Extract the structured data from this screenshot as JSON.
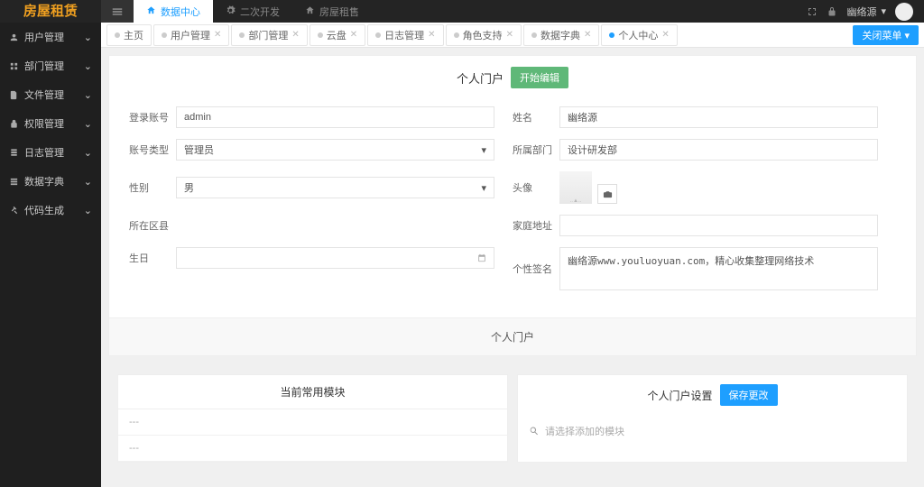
{
  "logo": "房屋租赁",
  "topnav": [
    {
      "label": "数据中心",
      "active": true
    },
    {
      "label": "二次开发",
      "active": false
    },
    {
      "label": "房屋租售",
      "active": false
    }
  ],
  "user": {
    "name": "幽络源"
  },
  "sidebar": [
    {
      "label": "用户管理"
    },
    {
      "label": "部门管理"
    },
    {
      "label": "文件管理"
    },
    {
      "label": "权限管理"
    },
    {
      "label": "日志管理"
    },
    {
      "label": "数据字典"
    },
    {
      "label": "代码生成"
    }
  ],
  "tabs": [
    {
      "label": "主页",
      "closable": false,
      "active": false
    },
    {
      "label": "用户管理",
      "closable": true,
      "active": false
    },
    {
      "label": "部门管理",
      "closable": true,
      "active": false
    },
    {
      "label": "云盘",
      "closable": true,
      "active": false
    },
    {
      "label": "日志管理",
      "closable": true,
      "active": false
    },
    {
      "label": "角色支持",
      "closable": true,
      "active": false
    },
    {
      "label": "数据字典",
      "closable": true,
      "active": false
    },
    {
      "label": "个人中心",
      "closable": true,
      "active": true
    }
  ],
  "close_all_label": "关闭菜单 ▾",
  "panel1": {
    "title": "个人门户",
    "edit_btn": "开始编辑",
    "fields": {
      "login_account_label": "登录账号",
      "login_account_value": "admin",
      "name_label": "姓名",
      "name_value": "幽络源",
      "account_type_label": "账号类型",
      "account_type_value": "管理员",
      "department_label": "所属部门",
      "department_value": "设计研发部",
      "gender_label": "性别",
      "gender_value": "男",
      "avatar_label": "头像",
      "region_label": "所在区县",
      "home_addr_label": "家庭地址",
      "birthday_label": "生日",
      "signature_label": "个性签名",
      "signature_value": "幽络源www.youluoyuan.com，精心收集整理网络技术"
    }
  },
  "section2_title": "个人门户",
  "portal": {
    "left_title": "当前常用模块",
    "modules": [
      "---",
      "---"
    ],
    "right_title": "个人门户设置",
    "save_btn": "保存更改",
    "search_placeholder": "请选择添加的模块"
  }
}
